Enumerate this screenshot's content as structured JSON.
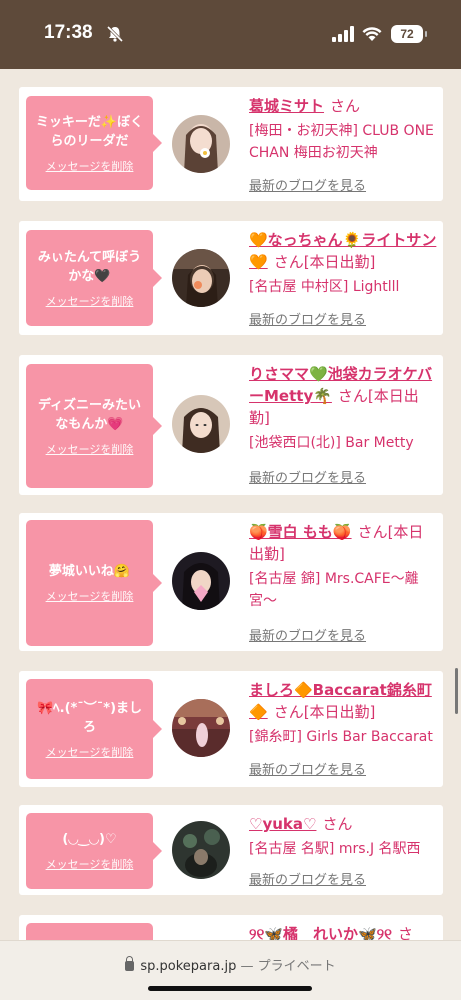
{
  "status": {
    "time": "17:38",
    "battery": "72"
  },
  "cards": [
    {
      "message": "ミッキーだ✨ぼくらのリーダだ",
      "delete": "メッセージを削除",
      "name": "葛城ミサト",
      "san": "さん",
      "shop": "[梅田・お初天神] CLUB ONE CHAN 梅田お初天神",
      "blog": "最新のブログを見る"
    },
    {
      "message": "みぃたんて呼ぼうかな🖤",
      "delete": "メッセージを削除",
      "name": "🧡なっちゃん🌻ライトサン🧡",
      "san": "さん[本日出勤]",
      "shop": "[名古屋 中村区] Lightlll",
      "blog": "最新のブログを見る"
    },
    {
      "message": "ディズニーみたいなもんか💗",
      "delete": "メッセージを削除",
      "name": "りさママ💚池袋カラオケバーMetty🌴",
      "san": "さん[本日出勤]",
      "shop": "[池袋西口(北)] Bar Metty",
      "blog": "最新のブログを見る"
    },
    {
      "message": "夢城いいね🤗",
      "delete": "メッセージを削除",
      "name": "🍑雪白 もも🍑",
      "san": "さん[本日出勤]",
      "shop": "[名古屋 錦] Mrs.CAFE〜離宮〜",
      "blog": "最新のブログを見る"
    },
    {
      "message": "🎀ﾍ.(*¯︶¯*)ましろ",
      "delete": "メッセージを削除",
      "name": "ましろ🔶Baccarat錦糸町🔶",
      "san": "さん[本日出勤]",
      "shop": "[錦糸町] Girls Bar Baccarat",
      "blog": "最新のブログを見る"
    },
    {
      "message": "(◡‿◡)♡",
      "delete": "メッセージを削除",
      "name": "♡yuka♡",
      "san": "さん",
      "shop": "[名古屋 名駅] mrs.J 名駅西",
      "blog": "最新のブログを見る"
    },
    {
      "message": "",
      "delete": "",
      "name": "୨୧🦋橘　れいか🦋୨୧",
      "san": "さ",
      "shop": "",
      "blog": ""
    }
  ],
  "urlbar": {
    "domain": "sp.pokepara.jp",
    "separator": "—",
    "mode": "プライベート"
  },
  "colors": {
    "header": "#5e4a3a",
    "bubble": "#f795a7",
    "link": "#d6336c",
    "page": "#efe8df"
  }
}
